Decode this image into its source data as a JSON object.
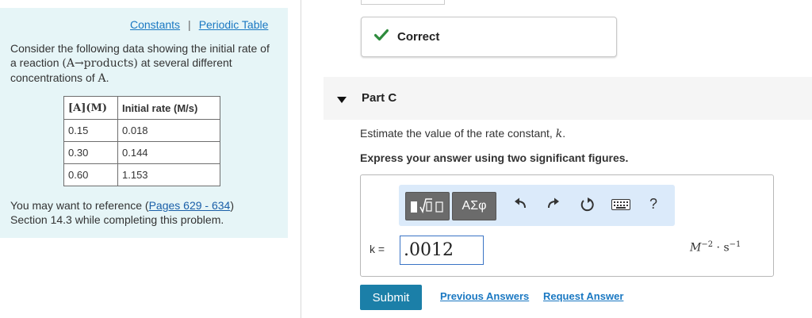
{
  "left_panel": {
    "links": {
      "constants": "Constants",
      "separator": "|",
      "periodic_table": "Periodic Table"
    },
    "intro_part1": "Consider the following data showing the initial rate of a reaction ",
    "intro_math": "(A→products)",
    "intro_part2": " at several different concentrations of ",
    "intro_math2": "A",
    "intro_end": ".",
    "table": {
      "headers": [
        "[A](M)",
        "Initial rate (M/s)"
      ],
      "rows": [
        [
          "0.15",
          "0.018"
        ],
        [
          "0.30",
          "0.144"
        ],
        [
          "0.60",
          "1.153"
        ]
      ]
    },
    "reference": {
      "prefix": "You may want to reference (",
      "link": "Pages 629 - 634",
      "suffix": ")",
      "line2": "Section 14.3 while completing this problem."
    }
  },
  "feedback": {
    "label": "Correct"
  },
  "part": {
    "label": "Part C"
  },
  "question": {
    "estimate": "Estimate the value of the rate constant, ",
    "estimate_var": "k",
    "estimate_end": ".",
    "express": "Express your answer using two significant figures."
  },
  "toolbar": {
    "greek_label": "ΑΣφ",
    "help_label": "?"
  },
  "answer": {
    "k_label": "k =",
    "value": ".0012",
    "units": {
      "base": "M",
      "exp1": "−2",
      "dot": " · ",
      "base2": "s",
      "exp2": "−1"
    }
  },
  "actions": {
    "submit": "Submit",
    "previous_answers": "Previous Answers",
    "request_answer": "Request Answer"
  },
  "colors": {
    "left_panel_bg": "#e6f5f7",
    "link": "#1a78c2",
    "check": "#2e8b3d",
    "submit_bg": "#1b7fa8",
    "toolbar_bg": "#dbeafa"
  }
}
